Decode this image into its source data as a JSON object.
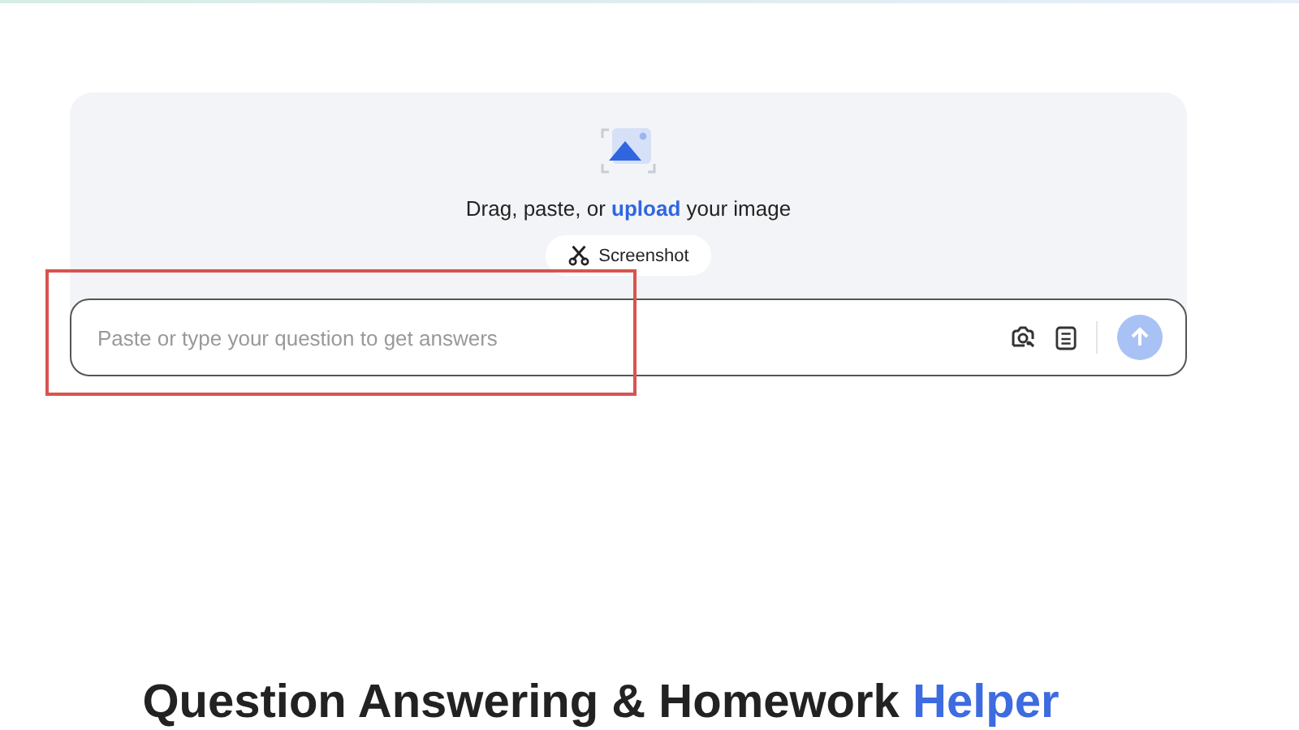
{
  "upload": {
    "prompt": "Drag, paste, or **upload** your image",
    "screenshot_button": "Screenshot"
  },
  "question_input": {
    "placeholder": "Paste or type your question to get answers",
    "highlighted": true
  },
  "heading": {
    "text": "Question Answering & Homework",
    "accent": "Helper"
  }
}
